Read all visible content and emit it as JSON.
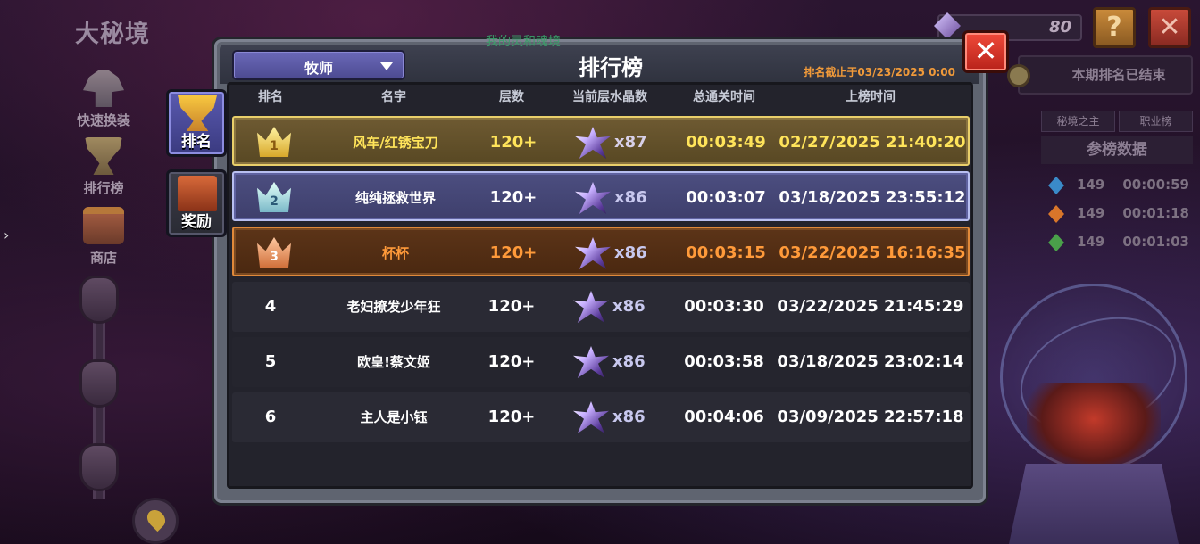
{
  "watermark": "我的灵和魂境",
  "sidebar": {
    "title": "大秘境",
    "items": [
      {
        "label": "快速换装",
        "icon": "outfit-icon"
      },
      {
        "label": "排行榜",
        "icon": "trophy-icon"
      },
      {
        "label": "商店",
        "icon": "shop-icon"
      }
    ],
    "expand_arrow": "›"
  },
  "hud": {
    "crystal_value": "80",
    "help_label": "?",
    "close_label": "✕",
    "period_text": "本期排名已结束",
    "tabs": [
      "秘境之主",
      "职业榜"
    ],
    "stats_title": "参榜数据",
    "stats": [
      {
        "gem": "blue",
        "color": "#3a8ac8",
        "count": "149",
        "time": "00:00:59"
      },
      {
        "gem": "orange",
        "color": "#d8762a",
        "count": "149",
        "time": "00:01:18"
      },
      {
        "gem": "green",
        "color": "#4aa04a",
        "count": "149",
        "time": "00:01:03"
      }
    ]
  },
  "panel": {
    "class_select": "牧师",
    "title": "排行榜",
    "deadline": "排名截止于03/23/2025 0:00",
    "close_label": "✕",
    "tabs": [
      {
        "label": "排名",
        "icon": "trophy-icon",
        "active": true
      },
      {
        "label": "奖励",
        "icon": "chest-icon",
        "active": false
      }
    ]
  },
  "table": {
    "headers": {
      "rank": "排名",
      "name": "名字",
      "floor": "层数",
      "crystals": "当前层水晶数",
      "total_time": "总通关时间",
      "listed_time": "上榜时间"
    },
    "rows": [
      {
        "rank": "1",
        "name": "风车/红锈宝刀",
        "floor": "120+",
        "crystals": "x87",
        "total_time": "00:03:49",
        "listed_time": "02/27/2025 21:40:20"
      },
      {
        "rank": "2",
        "name": "纯纯拯救世界",
        "floor": "120+",
        "crystals": "x86",
        "total_time": "00:03:07",
        "listed_time": "03/18/2025 23:55:12"
      },
      {
        "rank": "3",
        "name": "杯杯",
        "floor": "120+",
        "crystals": "x86",
        "total_time": "00:03:15",
        "listed_time": "03/22/2025 16:16:35"
      },
      {
        "rank": "4",
        "name": "老妇撩发少年狂",
        "floor": "120+",
        "crystals": "x86",
        "total_time": "00:03:30",
        "listed_time": "03/22/2025 21:45:29"
      },
      {
        "rank": "5",
        "name": "欧皇!蔡文姬",
        "floor": "120+",
        "crystals": "x86",
        "total_time": "00:03:58",
        "listed_time": "03/18/2025 23:02:14"
      },
      {
        "rank": "6",
        "name": "主人是小钰",
        "floor": "120+",
        "crystals": "x86",
        "total_time": "00:04:06",
        "listed_time": "03/09/2025 22:57:18"
      }
    ]
  }
}
